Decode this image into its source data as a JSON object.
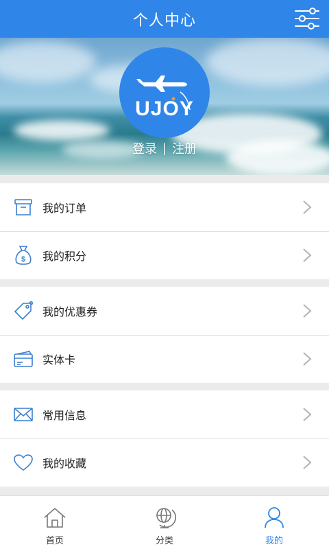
{
  "header": {
    "title": "个人中心"
  },
  "banner": {
    "logo_text": "UJOY",
    "login_label": "登录",
    "separator": "|",
    "register_label": "注册"
  },
  "menu": {
    "orders": "我的订单",
    "points": "我的积分",
    "coupons": "我的优惠券",
    "card": "实体卡",
    "info": "常用信息",
    "favorites": "我的收藏"
  },
  "tabs": {
    "home": "首页",
    "category": "分类",
    "mine": "我的"
  },
  "colors": {
    "brand": "#2f86e8",
    "icon": "#3a7fd0",
    "chevron": "#b3b3b3"
  }
}
